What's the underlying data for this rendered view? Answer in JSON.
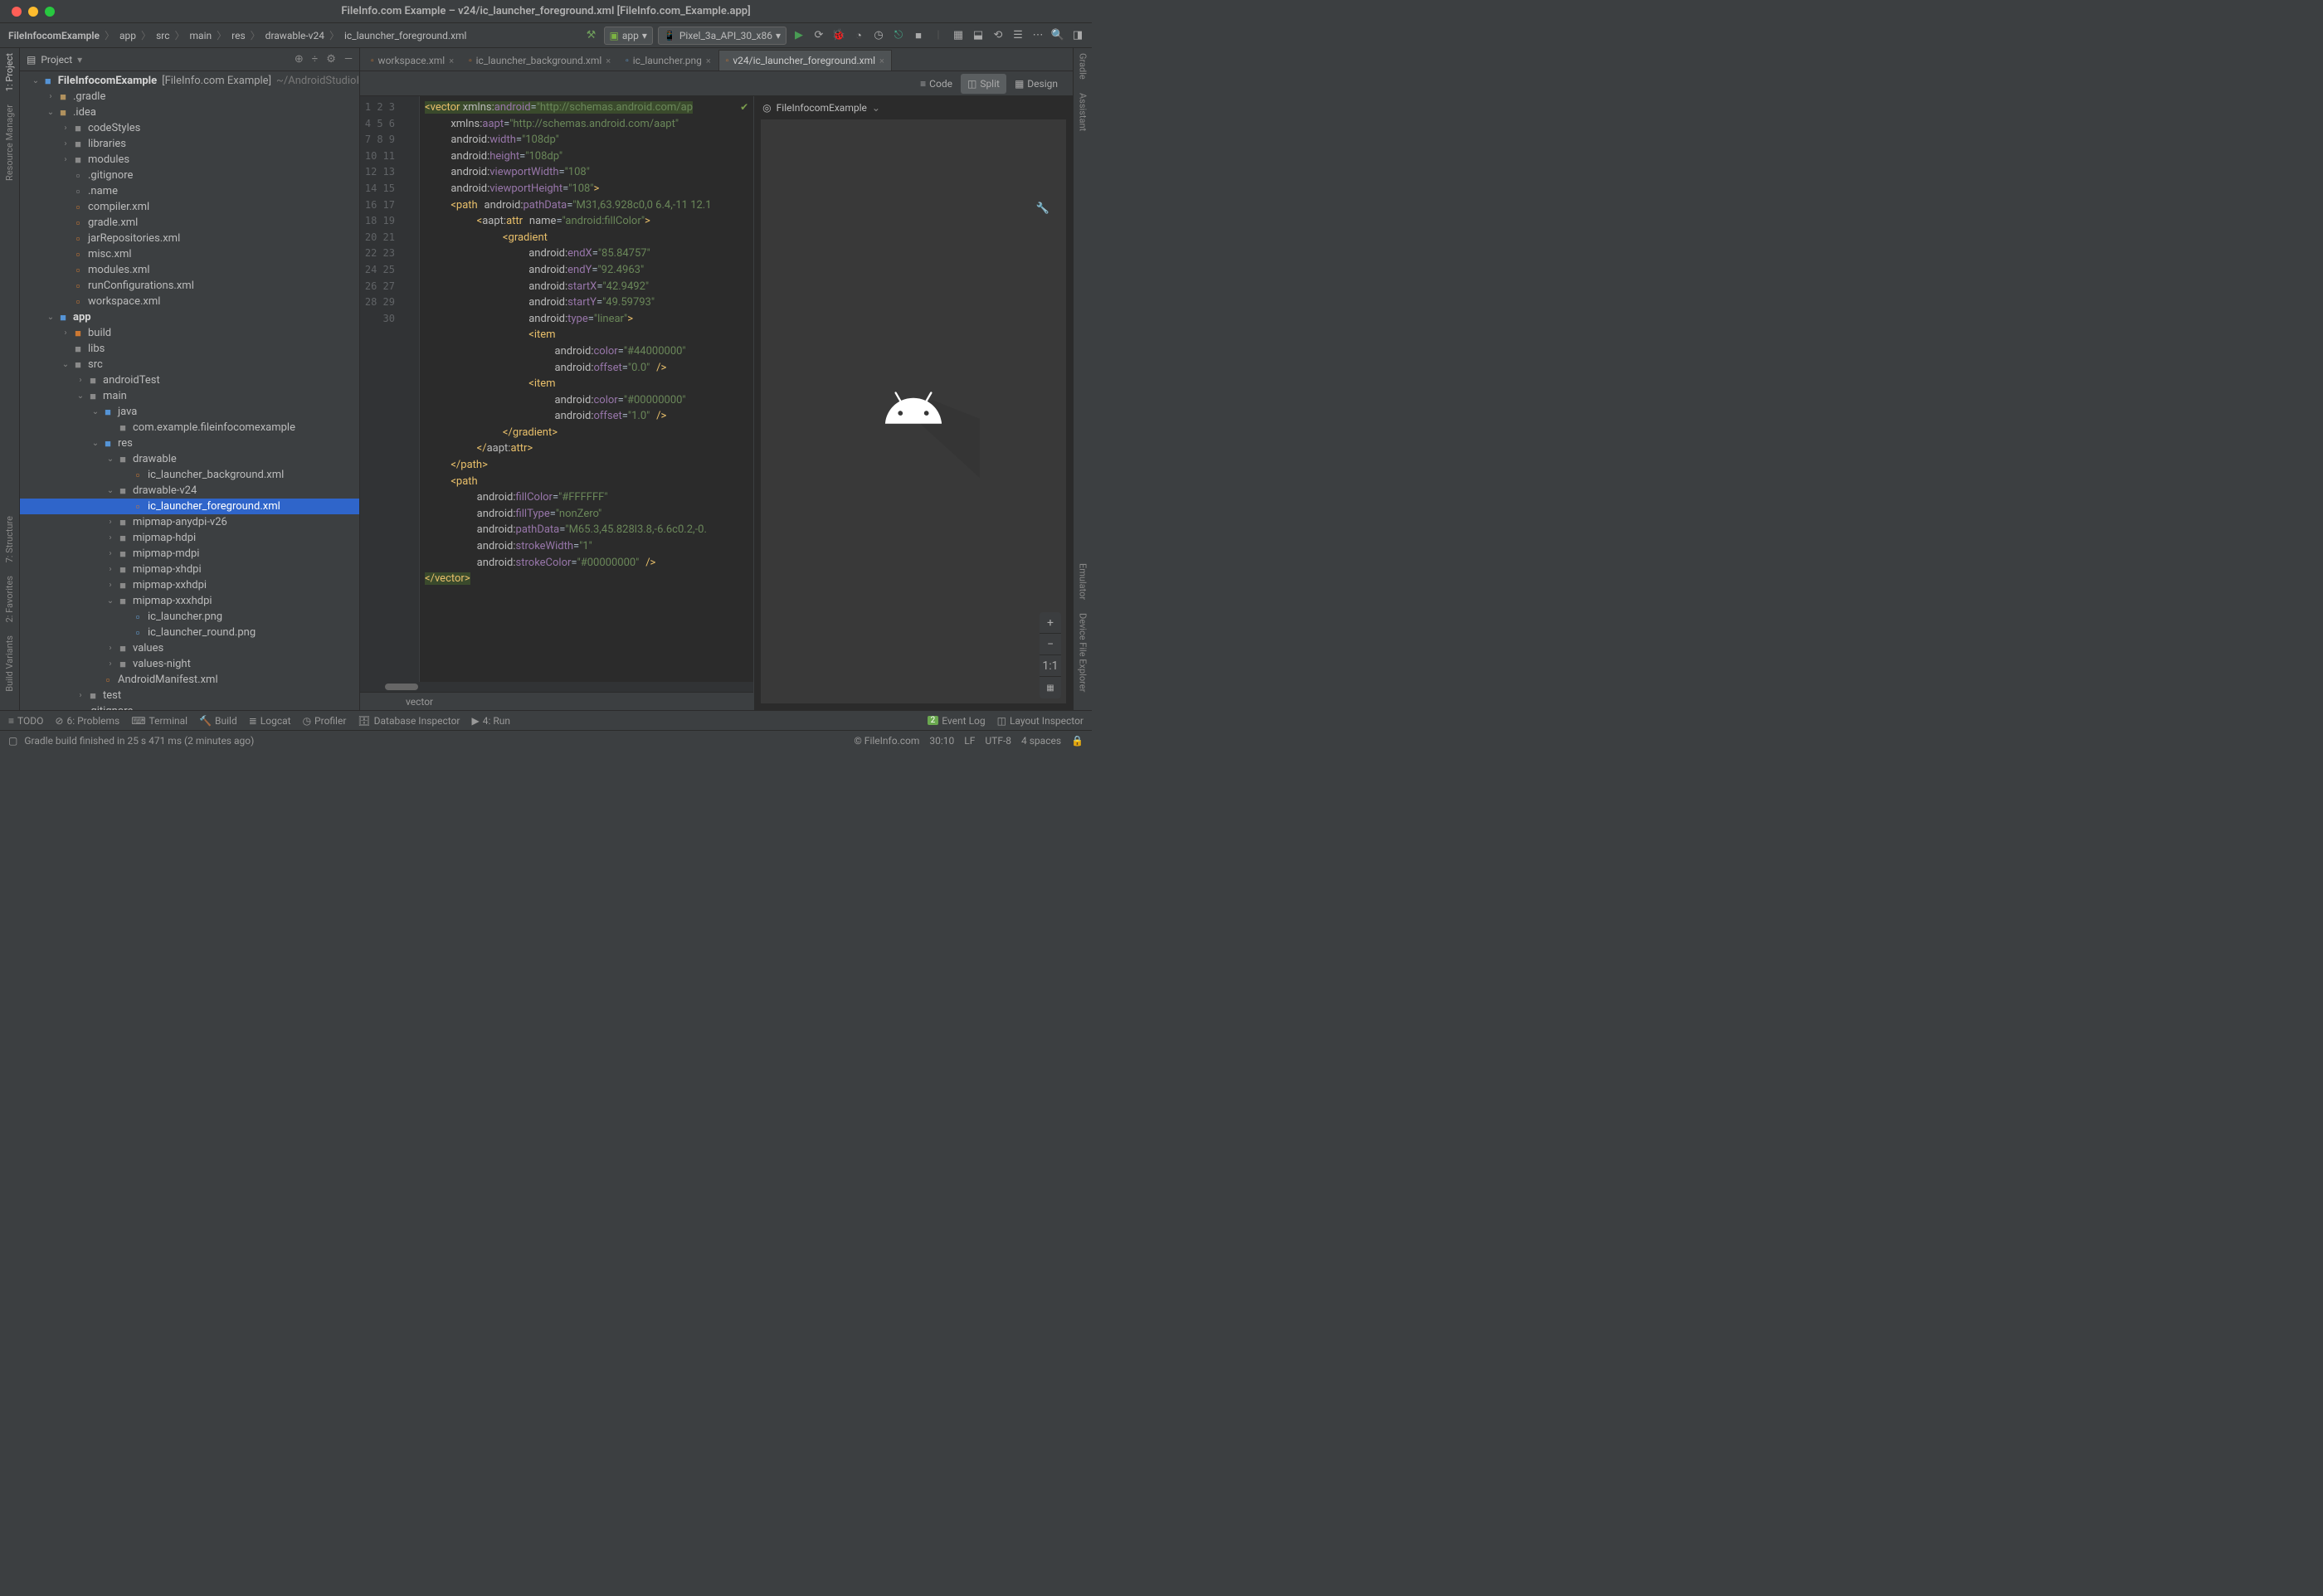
{
  "window": {
    "title": "FileInfo.com Example – v24/ic_launcher_foreground.xml [FileInfo.com_Example.app]"
  },
  "breadcrumb": [
    "FileInfocomExample",
    "app",
    "src",
    "main",
    "res",
    "drawable-v24",
    "ic_launcher_foreground.xml"
  ],
  "run_config": {
    "module": "app",
    "device": "Pixel_3a_API_30_x86"
  },
  "panel": {
    "title": "Project"
  },
  "tree": [
    {
      "d": 0,
      "a": "v",
      "i": "folder-blue",
      "t": "FileInfocomExample",
      "extra": "[FileInfo.com Example]",
      "extra2": "~/AndroidStudioI",
      "bold": true
    },
    {
      "d": 1,
      "a": ">",
      "i": "folder",
      "t": ".gradle"
    },
    {
      "d": 1,
      "a": "v",
      "i": "folder",
      "t": ".idea"
    },
    {
      "d": 2,
      "a": ">",
      "i": "folder-gray",
      "t": "codeStyles"
    },
    {
      "d": 2,
      "a": ">",
      "i": "folder-gray",
      "t": "libraries"
    },
    {
      "d": 2,
      "a": ">",
      "i": "folder-gray",
      "t": "modules"
    },
    {
      "d": 2,
      "a": "",
      "i": "file",
      "t": ".gitignore"
    },
    {
      "d": 2,
      "a": "",
      "i": "file",
      "t": ".name"
    },
    {
      "d": 2,
      "a": "",
      "i": "file-xml",
      "t": "compiler.xml"
    },
    {
      "d": 2,
      "a": "",
      "i": "file-xml",
      "t": "gradle.xml"
    },
    {
      "d": 2,
      "a": "",
      "i": "file-xml",
      "t": "jarRepositories.xml"
    },
    {
      "d": 2,
      "a": "",
      "i": "file-xml",
      "t": "misc.xml"
    },
    {
      "d": 2,
      "a": "",
      "i": "file-xml",
      "t": "modules.xml"
    },
    {
      "d": 2,
      "a": "",
      "i": "file-xml",
      "t": "runConfigurations.xml"
    },
    {
      "d": 2,
      "a": "",
      "i": "file-xml",
      "t": "workspace.xml"
    },
    {
      "d": 1,
      "a": "v",
      "i": "folder-blue",
      "t": "app",
      "bold": true
    },
    {
      "d": 2,
      "a": ">",
      "i": "folder-orange",
      "t": "build"
    },
    {
      "d": 2,
      "a": "",
      "i": "folder-gray",
      "t": "libs"
    },
    {
      "d": 2,
      "a": "v",
      "i": "folder-gray",
      "t": "src"
    },
    {
      "d": 3,
      "a": ">",
      "i": "folder-gray",
      "t": "androidTest"
    },
    {
      "d": 3,
      "a": "v",
      "i": "folder-gray",
      "t": "main"
    },
    {
      "d": 4,
      "a": "v",
      "i": "folder-blue",
      "t": "java"
    },
    {
      "d": 5,
      "a": "",
      "i": "folder-gray",
      "t": "com.example.fileinfocomexample"
    },
    {
      "d": 4,
      "a": "v",
      "i": "folder-blue",
      "t": "res"
    },
    {
      "d": 5,
      "a": "v",
      "i": "folder-gray",
      "t": "drawable"
    },
    {
      "d": 6,
      "a": "",
      "i": "file-xml",
      "t": "ic_launcher_background.xml"
    },
    {
      "d": 5,
      "a": "v",
      "i": "folder-gray",
      "t": "drawable-v24"
    },
    {
      "d": 6,
      "a": "",
      "i": "file-xml",
      "t": "ic_launcher_foreground.xml",
      "sel": true
    },
    {
      "d": 5,
      "a": ">",
      "i": "folder-gray",
      "t": "mipmap-anydpi-v26"
    },
    {
      "d": 5,
      "a": ">",
      "i": "folder-gray",
      "t": "mipmap-hdpi"
    },
    {
      "d": 5,
      "a": ">",
      "i": "folder-gray",
      "t": "mipmap-mdpi"
    },
    {
      "d": 5,
      "a": ">",
      "i": "folder-gray",
      "t": "mipmap-xhdpi"
    },
    {
      "d": 5,
      "a": ">",
      "i": "folder-gray",
      "t": "mipmap-xxhdpi"
    },
    {
      "d": 5,
      "a": "v",
      "i": "folder-gray",
      "t": "mipmap-xxxhdpi"
    },
    {
      "d": 6,
      "a": "",
      "i": "file-png",
      "t": "ic_launcher.png"
    },
    {
      "d": 6,
      "a": "",
      "i": "file-png",
      "t": "ic_launcher_round.png"
    },
    {
      "d": 5,
      "a": ">",
      "i": "folder-gray",
      "t": "values"
    },
    {
      "d": 5,
      "a": ">",
      "i": "folder-gray",
      "t": "values-night"
    },
    {
      "d": 4,
      "a": "",
      "i": "file-xml",
      "t": "AndroidManifest.xml"
    },
    {
      "d": 3,
      "a": ">",
      "i": "folder-gray",
      "t": "test"
    },
    {
      "d": 2,
      "a": "",
      "i": "file",
      "t": ".gitignore"
    }
  ],
  "editor_tabs": [
    {
      "icon": "file-xml",
      "label": "workspace.xml",
      "active": false
    },
    {
      "icon": "file-xml",
      "label": "ic_launcher_background.xml",
      "active": false
    },
    {
      "icon": "file-png",
      "label": "ic_launcher.png",
      "active": false
    },
    {
      "icon": "file-xml",
      "label": "v24/ic_launcher_foreground.xml",
      "active": true
    }
  ],
  "view_tabs": {
    "code": "Code",
    "split": "Split",
    "design": "Design"
  },
  "line_count": 30,
  "code_lines": [
    [
      [
        "tag",
        "<vector"
      ],
      [
        "plain",
        " "
      ],
      [
        "attr-ns",
        "xmlns:"
      ],
      [
        "attr",
        "android"
      ],
      [
        "eq",
        "="
      ],
      [
        "str",
        "\"http://schemas.android.com/ap"
      ]
    ],
    [
      [
        "plain",
        "    "
      ],
      [
        "attr-ns",
        "xmlns:"
      ],
      [
        "attr",
        "aapt"
      ],
      [
        "eq",
        "="
      ],
      [
        "str",
        "\"http://schemas.android.com/aapt\""
      ]
    ],
    [
      [
        "plain",
        "    "
      ],
      [
        "attr-ns",
        "android:"
      ],
      [
        "attr",
        "width"
      ],
      [
        "eq",
        "="
      ],
      [
        "str",
        "\"108dp\""
      ]
    ],
    [
      [
        "plain",
        "    "
      ],
      [
        "attr-ns",
        "android:"
      ],
      [
        "attr",
        "height"
      ],
      [
        "eq",
        "="
      ],
      [
        "str",
        "\"108dp\""
      ]
    ],
    [
      [
        "plain",
        "    "
      ],
      [
        "attr-ns",
        "android:"
      ],
      [
        "attr",
        "viewportWidth"
      ],
      [
        "eq",
        "="
      ],
      [
        "str",
        "\"108\""
      ]
    ],
    [
      [
        "plain",
        "    "
      ],
      [
        "attr-ns",
        "android:"
      ],
      [
        "attr",
        "viewportHeight"
      ],
      [
        "eq",
        "="
      ],
      [
        "str",
        "\"108\""
      ],
      [
        "tag",
        ">"
      ]
    ],
    [
      [
        "plain",
        "    "
      ],
      [
        "tag",
        "<path"
      ],
      [
        "plain",
        " "
      ],
      [
        "attr-ns",
        "android:"
      ],
      [
        "attr",
        "pathData"
      ],
      [
        "eq",
        "="
      ],
      [
        "str",
        "\"M31,63.928c0,0 6.4,-11 12.1"
      ]
    ],
    [
      [
        "plain",
        "        "
      ],
      [
        "tag",
        "<"
      ],
      [
        "attr-ns",
        "aapt:"
      ],
      [
        "tag",
        "attr"
      ],
      [
        "plain",
        " "
      ],
      [
        "attr-name",
        "name"
      ],
      [
        "eq",
        "="
      ],
      [
        "str",
        "\"android:fillColor\""
      ],
      [
        "tag",
        ">"
      ]
    ],
    [
      [
        "plain",
        "            "
      ],
      [
        "tag",
        "<gradient"
      ]
    ],
    [
      [
        "plain",
        "                "
      ],
      [
        "attr-ns",
        "android:"
      ],
      [
        "attr",
        "endX"
      ],
      [
        "eq",
        "="
      ],
      [
        "str",
        "\"85.84757\""
      ]
    ],
    [
      [
        "plain",
        "                "
      ],
      [
        "attr-ns",
        "android:"
      ],
      [
        "attr",
        "endY"
      ],
      [
        "eq",
        "="
      ],
      [
        "str",
        "\"92.4963\""
      ]
    ],
    [
      [
        "plain",
        "                "
      ],
      [
        "attr-ns",
        "android:"
      ],
      [
        "attr",
        "startX"
      ],
      [
        "eq",
        "="
      ],
      [
        "str",
        "\"42.9492\""
      ]
    ],
    [
      [
        "plain",
        "                "
      ],
      [
        "attr-ns",
        "android:"
      ],
      [
        "attr",
        "startY"
      ],
      [
        "eq",
        "="
      ],
      [
        "str",
        "\"49.59793\""
      ]
    ],
    [
      [
        "plain",
        "                "
      ],
      [
        "attr-ns",
        "android:"
      ],
      [
        "attr",
        "type"
      ],
      [
        "eq",
        "="
      ],
      [
        "str",
        "\"linear\""
      ],
      [
        "tag",
        ">"
      ]
    ],
    [
      [
        "plain",
        "                "
      ],
      [
        "tag",
        "<item"
      ]
    ],
    [
      [
        "plain",
        "                    "
      ],
      [
        "attr-ns",
        "android:"
      ],
      [
        "attr",
        "color"
      ],
      [
        "eq",
        "="
      ],
      [
        "str",
        "\"#44000000\""
      ]
    ],
    [
      [
        "plain",
        "                    "
      ],
      [
        "attr-ns",
        "android:"
      ],
      [
        "attr",
        "offset"
      ],
      [
        "eq",
        "="
      ],
      [
        "str",
        "\"0.0\""
      ],
      [
        "plain",
        " "
      ],
      [
        "tag",
        "/>"
      ]
    ],
    [
      [
        "plain",
        "                "
      ],
      [
        "tag",
        "<item"
      ]
    ],
    [
      [
        "plain",
        "                    "
      ],
      [
        "attr-ns",
        "android:"
      ],
      [
        "attr",
        "color"
      ],
      [
        "eq",
        "="
      ],
      [
        "str",
        "\"#00000000\""
      ]
    ],
    [
      [
        "plain",
        "                    "
      ],
      [
        "attr-ns",
        "android:"
      ],
      [
        "attr",
        "offset"
      ],
      [
        "eq",
        "="
      ],
      [
        "str",
        "\"1.0\""
      ],
      [
        "plain",
        " "
      ],
      [
        "tag",
        "/>"
      ]
    ],
    [
      [
        "plain",
        "            "
      ],
      [
        "tag",
        "</gradient>"
      ]
    ],
    [
      [
        "plain",
        "        "
      ],
      [
        "tag",
        "</"
      ],
      [
        "attr-ns",
        "aapt:"
      ],
      [
        "tag",
        "attr>"
      ]
    ],
    [
      [
        "plain",
        "    "
      ],
      [
        "tag",
        "</path>"
      ]
    ],
    [
      [
        "plain",
        "    "
      ],
      [
        "tag",
        "<path"
      ]
    ],
    [
      [
        "plain",
        "        "
      ],
      [
        "attr-ns",
        "android:"
      ],
      [
        "attr",
        "fillColor"
      ],
      [
        "eq",
        "="
      ],
      [
        "str",
        "\"#FFFFFF\""
      ]
    ],
    [
      [
        "plain",
        "        "
      ],
      [
        "attr-ns",
        "android:"
      ],
      [
        "attr",
        "fillType"
      ],
      [
        "eq",
        "="
      ],
      [
        "str",
        "\"nonZero\""
      ]
    ],
    [
      [
        "plain",
        "        "
      ],
      [
        "attr-ns",
        "android:"
      ],
      [
        "attr",
        "pathData"
      ],
      [
        "eq",
        "="
      ],
      [
        "str",
        "\"M65.3,45.828l3.8,-6.6c0.2,-0."
      ]
    ],
    [
      [
        "plain",
        "        "
      ],
      [
        "attr-ns",
        "android:"
      ],
      [
        "attr",
        "strokeWidth"
      ],
      [
        "eq",
        "="
      ],
      [
        "str",
        "\"1\""
      ]
    ],
    [
      [
        "plain",
        "        "
      ],
      [
        "attr-ns",
        "android:"
      ],
      [
        "attr",
        "strokeColor"
      ],
      [
        "eq",
        "="
      ],
      [
        "str",
        "\"#00000000\""
      ],
      [
        "plain",
        " "
      ],
      [
        "tag",
        "/>"
      ]
    ],
    [
      [
        "tag",
        "</vector>"
      ]
    ]
  ],
  "breadcrumb_bottom": "vector",
  "preview_title": "FileInfocomExample",
  "bottom_bar": {
    "todo": "TODO",
    "problems": "6: Problems",
    "terminal": "Terminal",
    "build": "Build",
    "logcat": "Logcat",
    "profiler": "Profiler",
    "db": "Database Inspector",
    "run": "4: Run",
    "eventlog": "Event Log",
    "layout_inspector": "Layout Inspector",
    "event_count": "2"
  },
  "status": {
    "message": "Gradle build finished in 25 s 471 ms (2 minutes ago)",
    "brand": "© FileInfo.com",
    "pos": "30:10",
    "sep": "LF",
    "enc": "UTF-8",
    "indent": "4 spaces"
  },
  "left_rail": [
    "1: Project",
    "Resource Manager"
  ],
  "right_rail": [
    "Gradle",
    "Assistant",
    "Emulator",
    "Device File Explorer"
  ],
  "left_bottom_rail": [
    "7: Structure",
    "2: Favorites",
    "Build Variants"
  ]
}
